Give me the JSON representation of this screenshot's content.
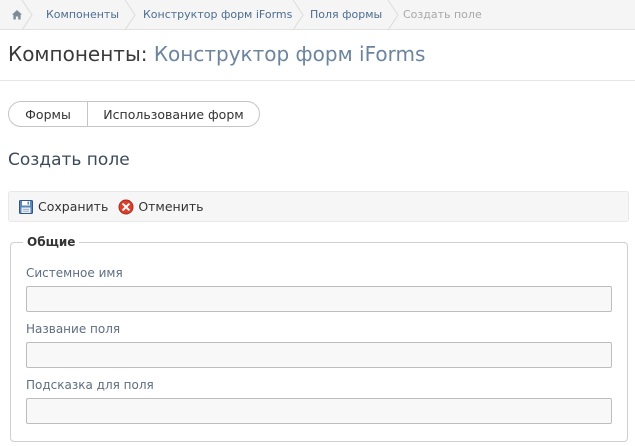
{
  "breadcrumb": {
    "home_icon": "home-icon",
    "items": [
      "Компоненты",
      "Конструктор форм iForms",
      "Поля формы",
      "Создать поле"
    ]
  },
  "page_title": {
    "prefix": "Компоненты:",
    "accent": "Конструктор форм iForms",
    "accent_color": "#6c849e"
  },
  "tabs": [
    {
      "label": "Формы"
    },
    {
      "label": "Использование форм"
    }
  ],
  "section_title": "Создать поле",
  "toolbar": {
    "save_label": "Сохранить",
    "save_icon": "floppy-disk-icon",
    "cancel_label": "Отменить",
    "cancel_icon": "cancel-icon",
    "cancel_color": "#d9412f"
  },
  "fieldset": {
    "legend": "Общие",
    "fields": [
      {
        "label": "Системное имя",
        "value": ""
      },
      {
        "label": "Название поля",
        "value": ""
      },
      {
        "label": "Подсказка для поля",
        "value": ""
      }
    ]
  }
}
